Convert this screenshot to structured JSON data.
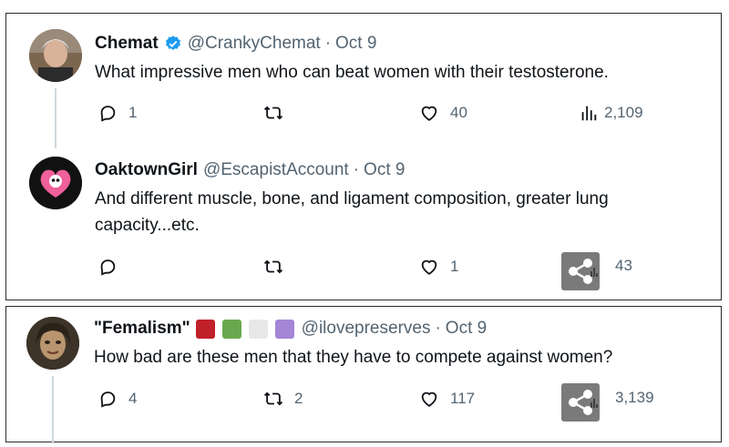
{
  "colors": {
    "verified": "#1d9bf0",
    "square1": "#c0202a",
    "square2": "#6aa84f",
    "square3": "#e8e8e8",
    "square4": "#a486d6",
    "share_bg": "#7a7a7a"
  },
  "tweets": [
    {
      "name": "Chemat",
      "verified": true,
      "handle": "@CrankyChemat",
      "sep": "·",
      "date": "Oct 9",
      "text": "What impressive men who can beat women with their testosterone.",
      "replies": "1",
      "retweets": "",
      "likes": "40",
      "views": "2,109"
    },
    {
      "name": "OaktownGirl",
      "handle": "@EscapistAccount",
      "sep": "·",
      "date": "Oct 9",
      "text_line1": "And different muscle, bone, and ligament composition, greater lung",
      "text_line2": "capacity...etc.",
      "replies": "",
      "retweets": "",
      "likes": "1",
      "views": "43"
    },
    {
      "name": "\"Femalism\"",
      "handle": "@ilovepreserves",
      "sep": "·",
      "date": "Oct 9",
      "text": "How bad are these men that they have to compete against women?",
      "replies": "4",
      "retweets": "2",
      "likes": "117",
      "views": "3,139"
    }
  ],
  "icons": [
    "reply-icon",
    "retweet-icon",
    "like-icon",
    "views-icon",
    "share-icon",
    "verified-icon"
  ]
}
